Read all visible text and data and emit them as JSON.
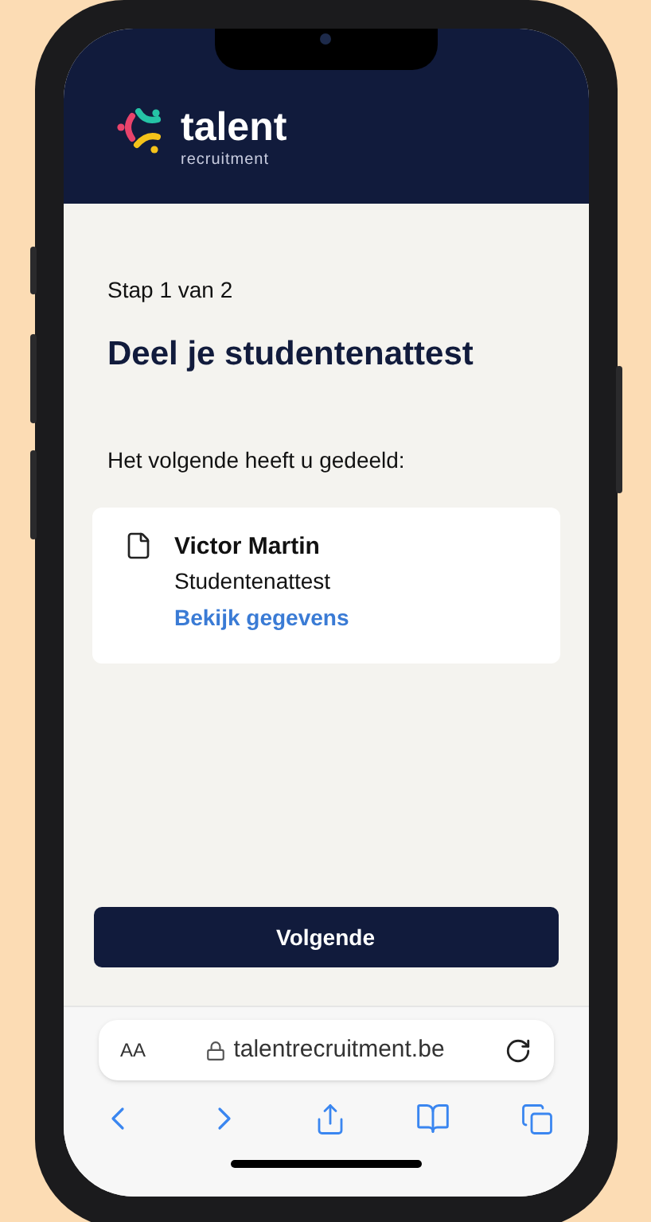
{
  "header": {
    "logo_title": "talent",
    "logo_subtitle": "recruitment"
  },
  "step": "Stap 1 van 2",
  "title": "Deel je studentenattest",
  "intro": "Het volgende heeft u gedeeld:",
  "card": {
    "name": "Victor Martin",
    "document": "Studentenattest",
    "link": "Bekijk gegevens"
  },
  "primary_button": "Volgende",
  "browser": {
    "text_size": "AA",
    "url": "talentrecruitment.be"
  }
}
